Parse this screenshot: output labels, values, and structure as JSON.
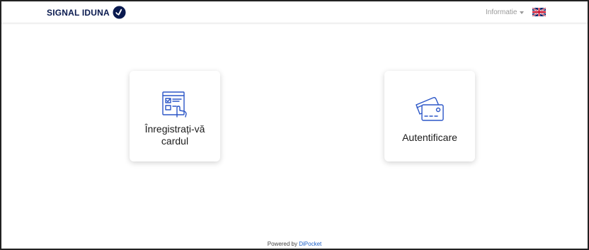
{
  "header": {
    "brand_name": "SIGNAL IDUNA",
    "info_menu_label": "Informatie",
    "language_flag": "uk-flag-icon"
  },
  "cards": [
    {
      "label": "Înregistrați-vă cardul",
      "icon": "registration-form-icon"
    },
    {
      "label": "Autentificare",
      "icon": "credit-card-icon"
    }
  ],
  "footer": {
    "powered_by_label": "Powered by",
    "provider_name": "DiPocket"
  },
  "colors": {
    "brand_navy": "#0a1a4f",
    "icon_blue": "#2b56c7",
    "link_blue": "#1a5fc8",
    "muted_gray": "#9a9a9a"
  }
}
